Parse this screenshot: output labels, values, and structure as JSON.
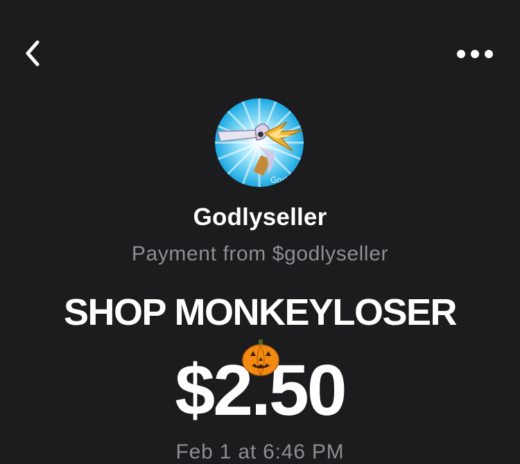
{
  "nav": {
    "back_icon": "chevron-left-icon",
    "more_icon": "more-horizontal-icon"
  },
  "profile": {
    "avatar_icon": "sword-avatar",
    "name": "Godlyseller",
    "subtitle": "Payment from $godlyseller"
  },
  "payment": {
    "note": "SHOP MONKEYLOSER",
    "note_emoji": "jack-o-lantern-icon",
    "amount": "$2.50",
    "date": "Feb 1 at 6:46 PM"
  },
  "colors": {
    "background": "#1c1c1e",
    "primary_text": "#ffffff",
    "secondary_text": "#8e8e93"
  }
}
